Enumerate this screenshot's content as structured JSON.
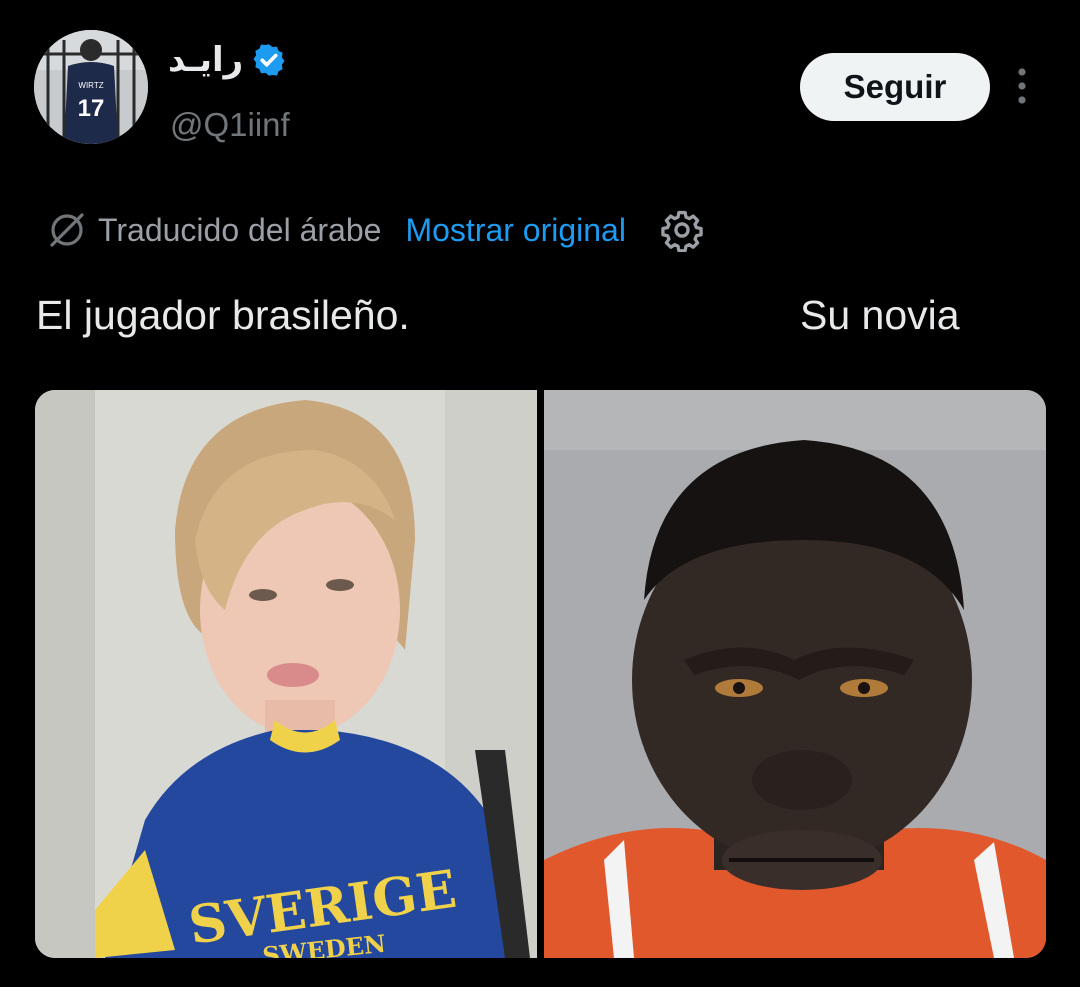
{
  "author": {
    "display_name": "رايـد",
    "handle": "@Q1iinf",
    "verified": true,
    "avatar": {
      "jersey_name": "WIRTZ",
      "jersey_number": "17"
    }
  },
  "actions": {
    "follow_label": "Seguir",
    "more_icon": "more-vertical-icon"
  },
  "translation": {
    "icon": "translate-icon",
    "label": "Traducido del árabe",
    "show_original": "Mostrar original",
    "settings_icon": "gear-icon"
  },
  "tweet": {
    "text_left": "El jugador brasileño.",
    "text_right": "Su novia"
  },
  "media": {
    "left_shirt_text_1": "SVERIGE",
    "left_shirt_text_2": "SWEDEN"
  },
  "colors": {
    "background": "#000000",
    "text": "#e7e9ea",
    "secondary": "#71767b",
    "link": "#1d9bf0",
    "verified": "#1d9bf0",
    "button_bg": "#eff3f4"
  }
}
